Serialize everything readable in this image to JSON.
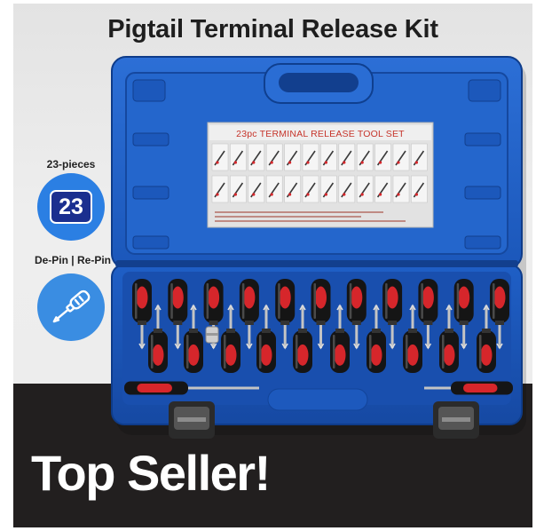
{
  "title": "Pigtail Terminal Release Kit",
  "badges": {
    "pieces_label": "23-pieces",
    "pieces_number": "23",
    "function_label": "De-Pin | Re-Pin",
    "function_icon": "screwdriver-icon"
  },
  "case": {
    "label_title": "23pc TERMINAL RELEASE TOOL SET"
  },
  "banner": {
    "text": "Top Seller!"
  },
  "colors": {
    "case_blue": "#1d5cc2",
    "badge_blue": "#2b7fe3",
    "badge_navy": "#1b2f8f",
    "handle_black": "#151515",
    "handle_red": "#d6262b",
    "steel": "#c4c4c4",
    "banner_dark": "#221f1f",
    "label_red": "#c6352b"
  }
}
